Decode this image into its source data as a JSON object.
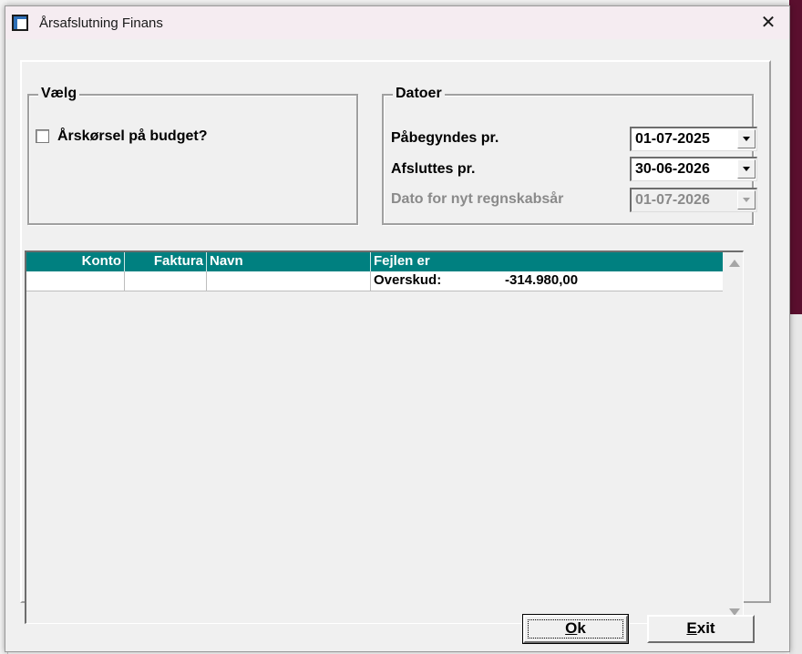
{
  "window": {
    "title": "Årsafslutning Finans",
    "close_glyph": "✕"
  },
  "vaelg": {
    "legend": "Vælg",
    "budget_checkbox_label": "Årskørsel på budget?",
    "budget_checked": false
  },
  "datoer": {
    "legend": "Datoer",
    "start_label": "Påbegyndes pr.",
    "start_value": "01-07-2025",
    "end_label": "Afsluttes pr.",
    "end_value": "30-06-2026",
    "new_year_label": "Dato for nyt regnskabsår",
    "new_year_value": "01-07-2026"
  },
  "grid": {
    "columns": [
      "Konto",
      "Faktura",
      "Navn",
      "Fejlen er"
    ],
    "rows": [
      {
        "konto": "",
        "faktura": "",
        "navn": "",
        "fejl_label": "Overskud:",
        "fejl_value": "-314.980,00"
      }
    ]
  },
  "buttons": {
    "ok_first": "O",
    "ok_rest": "k",
    "exit_first": "E",
    "exit_rest": "xit"
  },
  "colors": {
    "grid_header": "#008080",
    "title_bar": "#f5ecf1"
  }
}
